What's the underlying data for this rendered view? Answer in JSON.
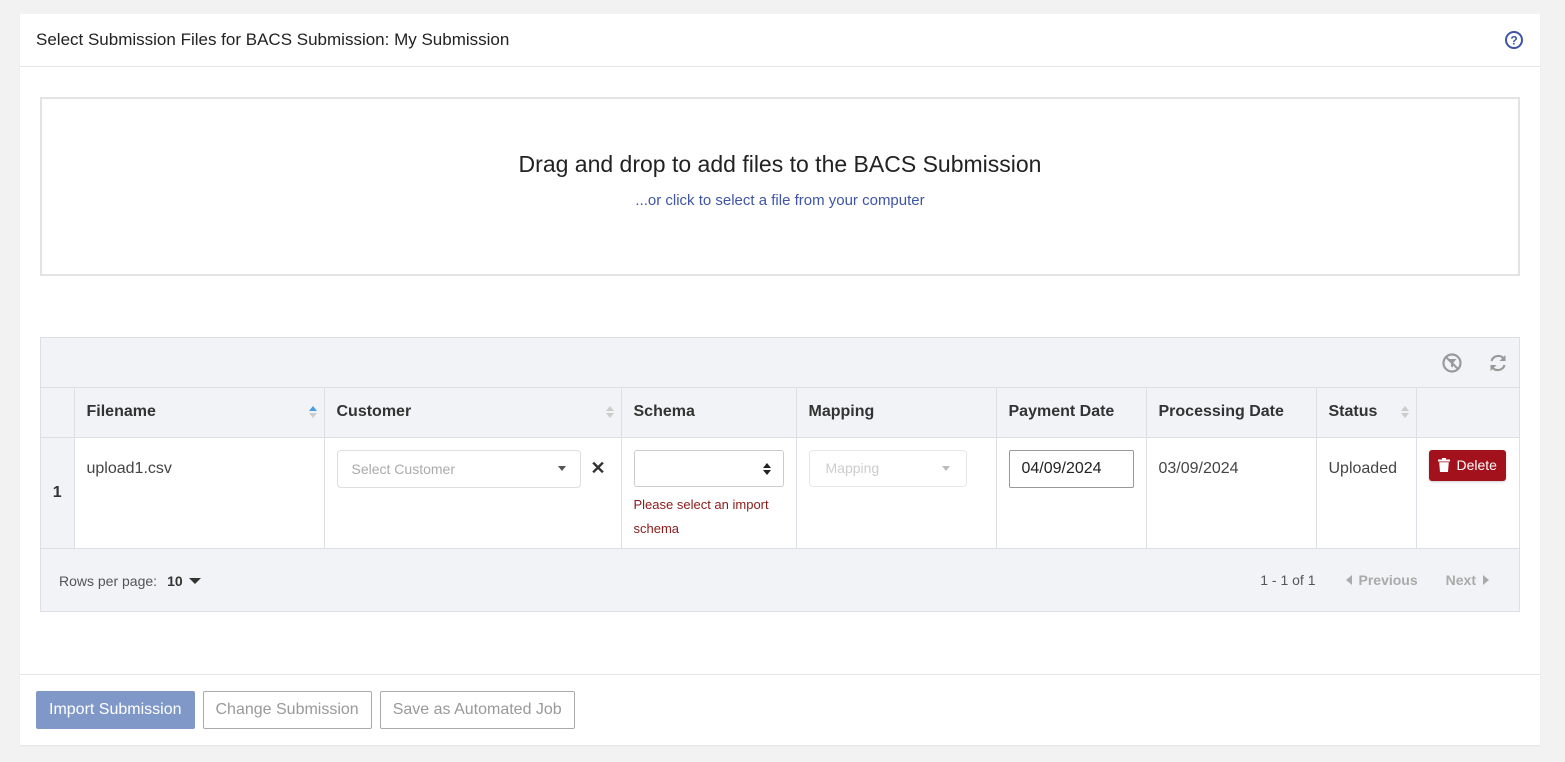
{
  "header": {
    "title": "Select Submission Files for BACS Submission: My Submission",
    "help_icon": "question-circle-icon"
  },
  "dropzone": {
    "title": "Drag and drop to add files to the BACS Submission",
    "link": "...or click to select a file from your computer"
  },
  "grid": {
    "toolbar_icons": [
      "filter-clear-icon",
      "refresh-icon"
    ],
    "columns": [
      "Filename",
      "Customer",
      "Schema",
      "Mapping",
      "Payment Date",
      "Processing Date",
      "Status"
    ],
    "rows": [
      {
        "index": "1",
        "filename": "upload1.csv",
        "customer_placeholder": "Select Customer",
        "clear": "✕",
        "schema_value": "",
        "schema_error": "Please select an import schema",
        "mapping_placeholder": "Mapping",
        "payment_date": "04/09/2024",
        "processing_date": "03/09/2024",
        "status": "Uploaded",
        "delete_label": "Delete"
      }
    ],
    "footer": {
      "rows_per_page_label": "Rows per page:",
      "rows_per_page_value": "10",
      "range": "1 - 1 of 1",
      "previous": "Previous",
      "next": "Next"
    }
  },
  "actions": {
    "import": "Import Submission",
    "change": "Change Submission",
    "save_job": "Save as Automated Job"
  },
  "colors": {
    "link": "#3f55a4",
    "delete": "#a3111d",
    "primary_disabled": "#8098c8",
    "error": "#8b1a1a"
  }
}
